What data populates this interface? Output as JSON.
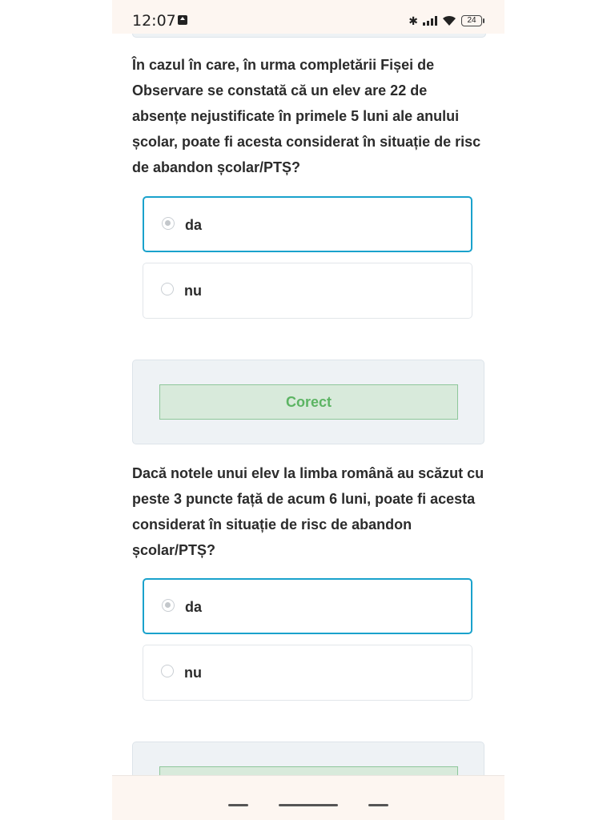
{
  "status_bar": {
    "time": "12:07",
    "battery": "24",
    "icons": [
      "upload-notification-icon",
      "bluetooth-icon",
      "signal-icon",
      "wifi-icon",
      "battery-icon"
    ]
  },
  "questions": [
    {
      "text": "În cazul în care, în urma completării Fișei de Observare se constată că un elev are 22 de absențe nejustificate în primele 5 luni ale anului școlar, poate fi acesta considerat în situație de risc de abandon școlar/PTȘ?",
      "options": [
        {
          "label": "da",
          "selected": true
        },
        {
          "label": "nu",
          "selected": false
        }
      ],
      "feedback": "Corect"
    },
    {
      "text": "Dacă notele unui elev la limba română au scăzut cu peste 3 puncte față de acum 6 luni, poate fi acesta considerat în situație de risc de abandon școlar/PTȘ?",
      "options": [
        {
          "label": "da",
          "selected": true
        },
        {
          "label": "nu",
          "selected": false
        }
      ],
      "feedback": ""
    }
  ],
  "colors": {
    "selected_border": "#1aa2cc",
    "correct_bg": "#d8eadb",
    "correct_text": "#5cb463",
    "card_bg": "#eef2f5",
    "system_bar_bg": "#fdf6f1"
  }
}
